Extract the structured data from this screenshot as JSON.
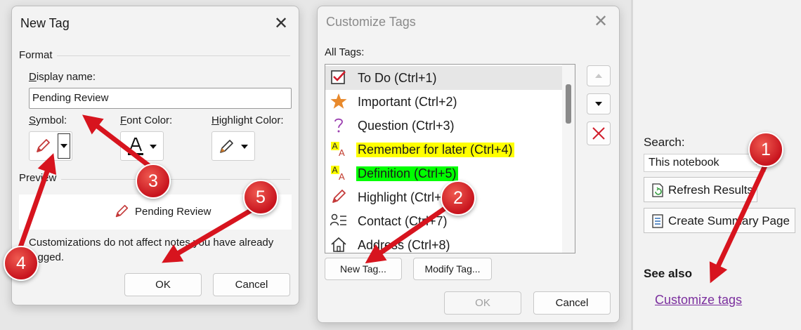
{
  "new_tag_dialog": {
    "title": "New Tag",
    "format_label": "Format",
    "display_name_label": "Display name:",
    "display_name_value": "Pending Review",
    "symbol_label": "Symbol:",
    "font_color_label": "Font Color:",
    "highlight_color_label": "Highlight Color:",
    "preview_label": "Preview",
    "preview_text": "Pending Review",
    "note": "Customizations do not affect notes you have already tagged.",
    "ok_label": "OK",
    "cancel_label": "Cancel"
  },
  "customize_tags_dialog": {
    "title": "Customize Tags",
    "all_tags_label": "All Tags:",
    "tags": [
      {
        "label": "To Do (Ctrl+1)",
        "icon": "checkbox-checked-icon",
        "highlight": ""
      },
      {
        "label": "Important (Ctrl+2)",
        "icon": "star-icon",
        "highlight": ""
      },
      {
        "label": "Question (Ctrl+3)",
        "icon": "question-mark-icon",
        "highlight": ""
      },
      {
        "label": "Remember for later (Ctrl+4)",
        "icon": "text-highlight-icon",
        "highlight": "#ffff00"
      },
      {
        "label": "Definition (Ctrl+5)",
        "icon": "text-highlight-icon",
        "highlight": "#00ff00"
      },
      {
        "label": "Highlight (Ctrl+6)",
        "icon": "pencil-icon",
        "highlight": ""
      },
      {
        "label": "Contact (Ctrl+7)",
        "icon": "contact-icon",
        "highlight": ""
      },
      {
        "label": "Address (Ctrl+8)",
        "icon": "home-icon",
        "highlight": ""
      }
    ],
    "new_tag_label": "New Tag...",
    "modify_tag_label": "Modify Tag...",
    "ok_label": "OK",
    "cancel_label": "Cancel"
  },
  "right_pane": {
    "search_label": "Search:",
    "search_scope": "This notebook",
    "refresh_label": "Refresh Results",
    "summary_label": "Create Summary Page",
    "see_also_label": "See also",
    "customize_link": "Customize tags"
  },
  "annotations": {
    "step1": "1",
    "step2": "2",
    "step3": "3",
    "step4": "4",
    "step5": "5",
    "color": "#d7141e"
  }
}
